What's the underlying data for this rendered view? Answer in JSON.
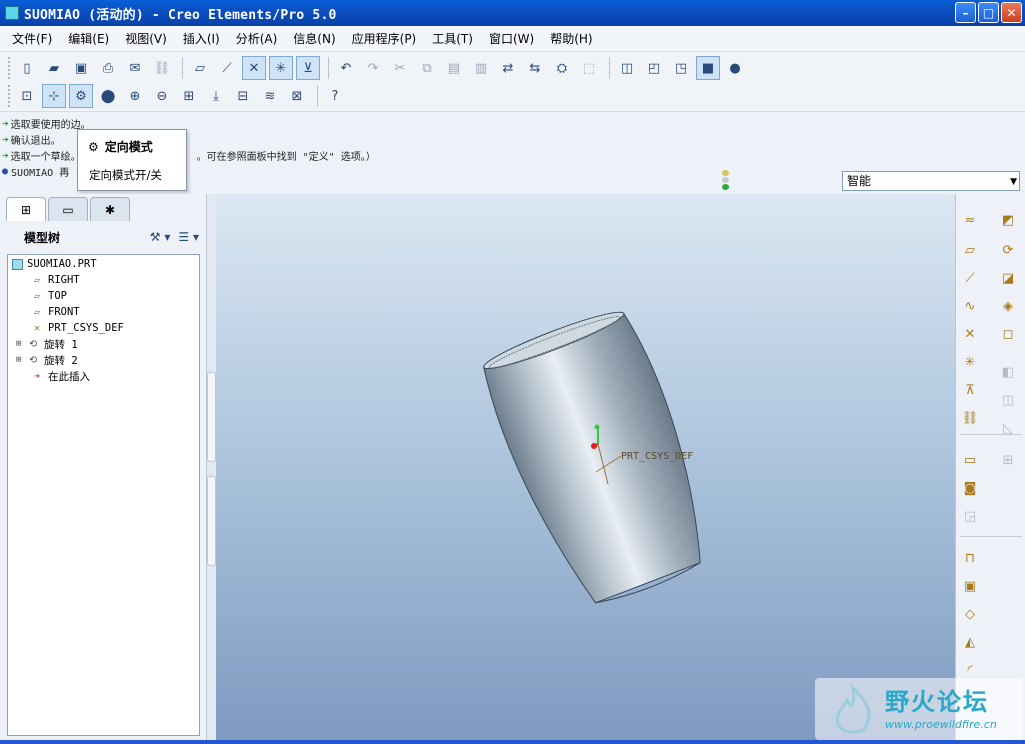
{
  "window": {
    "title": "SUOMIAO (活动的) - Creo Elements/Pro 5.0",
    "controls": [
      "minimize",
      "maximize",
      "close"
    ]
  },
  "menu": [
    {
      "label": "文件(F)"
    },
    {
      "label": "编辑(E)"
    },
    {
      "label": "视图(V)"
    },
    {
      "label": "插入(I)"
    },
    {
      "label": "分析(A)"
    },
    {
      "label": "信息(N)"
    },
    {
      "label": "应用程序(P)"
    },
    {
      "label": "工具(T)"
    },
    {
      "label": "窗口(W)"
    },
    {
      "label": "帮助(H)"
    }
  ],
  "messages": [
    "选取要使用的边。",
    "确认退出。",
    "选取一个草绘。",
    "SUOMIAO 再"
  ],
  "message_tail": "。可在参照面板中找到 \"定义\" 选项。）",
  "tooltip": {
    "title": "定向模式",
    "description": "定向模式开/关"
  },
  "filter": {
    "value": "智能"
  },
  "left_panel": {
    "title": "模型树",
    "tabs": [
      "model-tree",
      "layers",
      "favorites"
    ]
  },
  "tree": [
    {
      "label": "SUOMIAO.PRT",
      "icon": "part-icon"
    },
    {
      "label": "RIGHT",
      "icon": "datum-plane-icon"
    },
    {
      "label": "TOP",
      "icon": "datum-plane-icon"
    },
    {
      "label": "FRONT",
      "icon": "datum-plane-icon"
    },
    {
      "label": "PRT_CSYS_DEF",
      "icon": "csys-icon"
    },
    {
      "label": "旋转 1",
      "icon": "revolve-icon"
    },
    {
      "label": "旋转 2",
      "icon": "revolve-icon"
    },
    {
      "label": "在此插入",
      "icon": "insert-arrow-icon"
    }
  ],
  "graphics": {
    "csys_label": "PRT_CSYS_DEF"
  },
  "watermark": {
    "title": "野火论坛",
    "url": "www.proewildfire.cn"
  },
  "colors": {
    "titlebar": "#0a4ec0",
    "accent": "#2aa7c9",
    "part": "#9aa9b6"
  }
}
